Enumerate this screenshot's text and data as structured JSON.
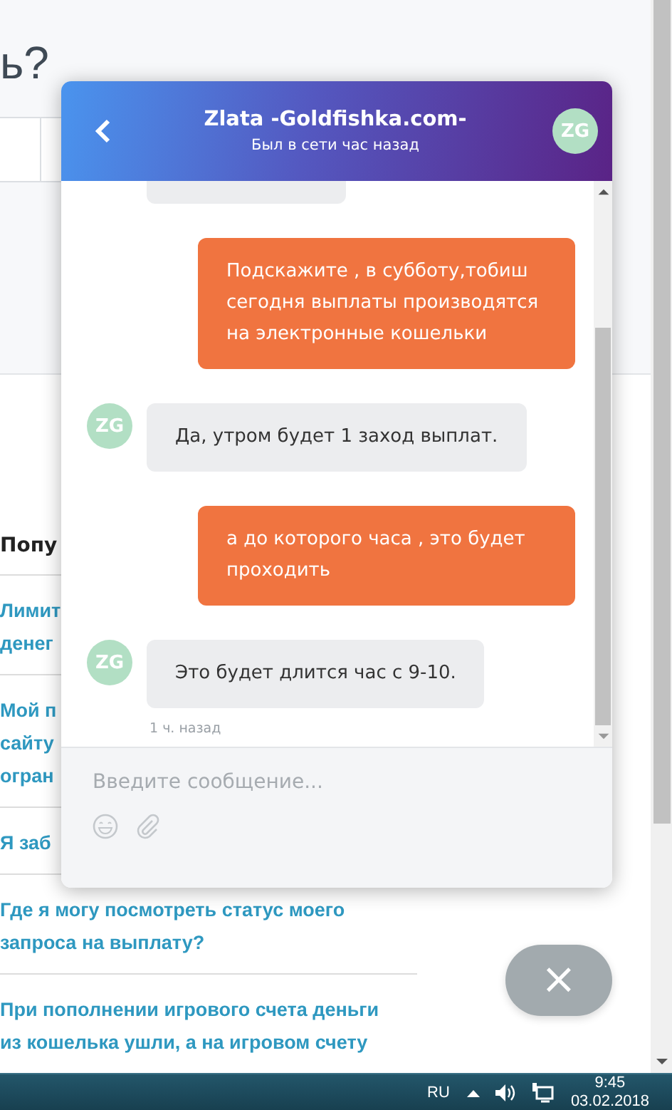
{
  "page": {
    "heading": "ь?",
    "popular": {
      "title": "Попу",
      "items": [
        {
          "lines": [
            "Лимит",
            "денег"
          ]
        },
        {
          "lines": [
            "Мой п",
            "сайту",
            "огран"
          ]
        },
        {
          "lines": [
            "Я заб"
          ]
        },
        {
          "lines": [
            "Где я могу посмотреть статус моего",
            "запроса на выплату?"
          ]
        },
        {
          "lines": [
            "При пополнении игрового счета деньги",
            "из кошелька ушли, а на игровом счету"
          ]
        }
      ]
    }
  },
  "chat": {
    "title": "Zlata -Goldfishka.com-",
    "subtitle": "Был в сети час назад",
    "avatar": "ZG",
    "messages": [
      {
        "kind": "fragment"
      },
      {
        "kind": "outgoing",
        "text": "Подскажите , в субботу,тобиш сегодня выплаты производятся на электронные кошельки"
      },
      {
        "kind": "incoming",
        "avatar": "ZG",
        "text": "Да, утром будет 1 заход выплат."
      },
      {
        "kind": "outgoing",
        "text": "а до которого часа , это будет проходить"
      },
      {
        "kind": "incoming",
        "avatar": "ZG",
        "text": "Это будет длится час с 9-10.",
        "time": "1 ч. назад"
      }
    ],
    "input": {
      "placeholder": "Введите сообщение..."
    }
  },
  "close_button": {
    "label": "×"
  },
  "taskbar": {
    "language": "RU",
    "time": "9:45",
    "date": "03.02.2018"
  }
}
